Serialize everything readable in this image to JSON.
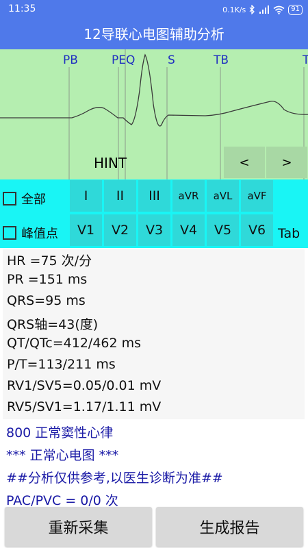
{
  "status_bar": {
    "time": "11:35",
    "speed": "0.1K/s",
    "bluetooth_icon": "bluetooth-icon",
    "signal_icon": "signal-icon",
    "wifi_icon": "wifi-icon",
    "battery": "91"
  },
  "app_bar": {
    "title": "12导联心电图辅助分析"
  },
  "ecg": {
    "markers": [
      "PB",
      "PEQ",
      "S",
      "TB",
      "T"
    ],
    "hint": "HINT",
    "prev_label": "<",
    "next_label": ">",
    "colors": {
      "background": "#b5eeb0",
      "trace": "#3a3a3a",
      "marker_text": "#1f2fc0"
    }
  },
  "leads": {
    "all_label": "全部",
    "peak_label": "峰值点",
    "row1": [
      "I",
      "II",
      "III",
      "aVR",
      "aVL",
      "aVF"
    ],
    "row2": [
      "V1",
      "V2",
      "V3",
      "V4",
      "V5",
      "V6"
    ],
    "tab_label": "Tab"
  },
  "results": [
    "HR =75 次/分",
    "PR =151 ms",
    "QRS=95 ms",
    "QRS轴=43(度)",
    "QT/QTc=412/462 ms",
    "P/T=113/211 ms",
    "RV1/SV5=0.05/0.01 mV",
    "RV5/SV1=1.17/1.11 mV"
  ],
  "diagnosis": [
    "800 正常窦性心律",
    "*** 正常心电图 ***",
    "##分析仅供参考,以医生诊断为准##",
    "PAC/PVC = 0/0 次"
  ],
  "buttons": {
    "recollect": "重新采集",
    "report": "生成报告"
  },
  "colors": {
    "app_bar": "#4f79ea",
    "lead_panel": "#19f5f5",
    "lead_button": "#2fd9d9",
    "diagnosis_text": "#1a1aa6"
  }
}
